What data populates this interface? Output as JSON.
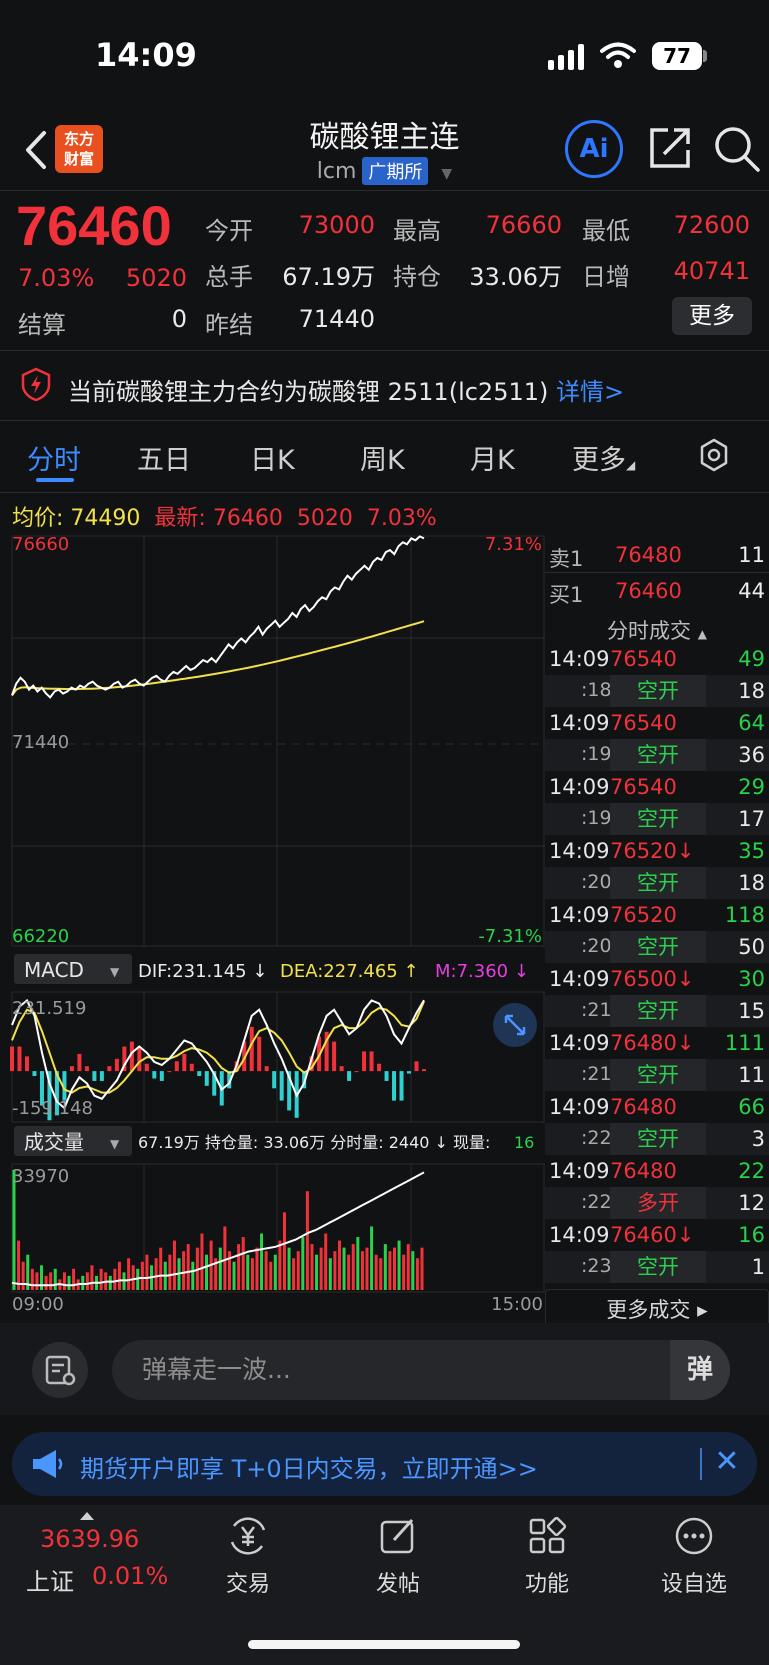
{
  "status": {
    "time": "14:09",
    "battery": "77"
  },
  "header": {
    "logo_line1": "东方",
    "logo_line2": "财富",
    "title": "碳酸锂主连",
    "code": "lcm",
    "exchange": "广期所",
    "ai_label": "Ai"
  },
  "quote": {
    "last": "76460",
    "change_pct": "7.03%",
    "change": "5020",
    "open_label": "今开",
    "open": "73000",
    "high_label": "最高",
    "high": "76660",
    "low_label": "最低",
    "low": "72600",
    "volume_label": "总手",
    "volume": "67.19万",
    "oi_label": "持仓",
    "oi": "33.06万",
    "daily_inc_label": "日增",
    "daily_inc": "40741",
    "settle_label": "结算",
    "settle": "0",
    "prev_settle_label": "昨结",
    "prev_settle": "71440",
    "more": "更多"
  },
  "notice": {
    "text": "当前碳酸锂主力合约为碳酸锂 2511(lc2511)",
    "link": "详情>"
  },
  "tabs": [
    "分时",
    "五日",
    "日K",
    "周K",
    "月K",
    "更多"
  ],
  "info_line": {
    "avg_label": "均价:",
    "avg": "74490",
    "latest_label": "最新:",
    "latest": "76460",
    "latest_change": "5020",
    "latest_pct": "7.03%"
  },
  "chart_data": {
    "type": "line",
    "price_axis": {
      "top": "76660",
      "mid": "71440",
      "bottom": "66220",
      "top_pct": "7.31%",
      "bottom_pct": "-7.31%",
      "ylim": [
        66220,
        76660
      ],
      "prev_settle": 71440
    },
    "x_labels": {
      "start": "09:00",
      "end": "15:00"
    },
    "series": [
      {
        "name": "最新",
        "color": "#ffffff",
        "values": [
          72600,
          72900,
          73050,
          72950,
          72750,
          72850,
          72700,
          72800,
          72650,
          72550,
          72700,
          72750,
          72650,
          72700,
          72800,
          72750,
          72850,
          72800,
          72900,
          72950,
          72850,
          72800,
          72750,
          72800,
          72900,
          72950,
          72800,
          72850,
          72950,
          73000,
          72900,
          72850,
          72950,
          73050,
          73100,
          73000,
          72950,
          73100,
          73200,
          73150,
          73250,
          73350,
          73250,
          73300,
          73400,
          73500,
          73450,
          73550,
          73450,
          73600,
          73750,
          73900,
          73800,
          73950,
          74050,
          73950,
          74100,
          74200,
          74350,
          74150,
          74300,
          74400,
          74500,
          74350,
          74450,
          74550,
          74700,
          74600,
          74800,
          74900,
          74750,
          74850,
          75000,
          75100,
          75050,
          75250,
          75350,
          75300,
          75500,
          75650,
          75550,
          75700,
          75800,
          75900,
          75800,
          76000,
          76100,
          76050,
          76250,
          76300,
          76200,
          76400,
          76500,
          76450,
          76600,
          76550,
          76650,
          76600
        ]
      },
      {
        "name": "均价",
        "color": "#f2e14a",
        "values": [
          72600,
          72750,
          72800,
          72810,
          72800,
          72790,
          72785,
          72780,
          72775,
          72770,
          72768,
          72766,
          72764,
          72762,
          72762,
          72764,
          72766,
          72768,
          72772,
          72778,
          72784,
          72790,
          72798,
          72806,
          72815,
          72825,
          72836,
          72848,
          72860,
          72873,
          72886,
          72900,
          72915,
          72930,
          72946,
          72962,
          72978,
          72994,
          73010,
          73026,
          73043,
          73060,
          73078,
          73096,
          73114,
          73133,
          73152,
          73172,
          73192,
          73213,
          73234,
          73256,
          73278,
          73300,
          73323,
          73347,
          73371,
          73396,
          73421,
          73447,
          73473,
          73500,
          73527,
          73555,
          73583,
          73611,
          73640,
          73669,
          73698,
          73727,
          73756,
          73785,
          73815,
          73845,
          73875,
          73905,
          73936,
          73967,
          73998,
          74030,
          74062,
          74094,
          74126,
          74159,
          74192,
          74225,
          74258,
          74291,
          74324,
          74357,
          74390,
          74423,
          74456,
          74490
        ]
      }
    ],
    "macd": {
      "selector": "MACD",
      "dif_label": "DIF:231.145 ↓",
      "dea_label": "DEA:227.465 ↑",
      "m_label": "M:7.360 ↓",
      "top": "231.519",
      "bottom": "-159.148",
      "dif": [
        150,
        210,
        230,
        180,
        60,
        -40,
        -100,
        -120,
        -60,
        -20,
        -40,
        -80,
        -90,
        -60,
        -30,
        20,
        60,
        80,
        60,
        30,
        20,
        40,
        70,
        100,
        90,
        60,
        30,
        -10,
        -60,
        -40,
        20,
        100,
        180,
        200,
        150,
        90,
        40,
        -20,
        -80,
        -40,
        40,
        120,
        180,
        200,
        160,
        120,
        140,
        200,
        230,
        220,
        180,
        120,
        90,
        140,
        190,
        231
      ],
      "dea": [
        100,
        160,
        200,
        190,
        130,
        60,
        -10,
        -60,
        -70,
        -55,
        -50,
        -60,
        -70,
        -70,
        -55,
        -30,
        0,
        30,
        45,
        45,
        40,
        40,
        50,
        65,
        75,
        70,
        60,
        40,
        10,
        -5,
        0,
        40,
        90,
        130,
        140,
        125,
        100,
        60,
        15,
        -5,
        10,
        50,
        100,
        140,
        150,
        140,
        140,
        160,
        190,
        205,
        200,
        180,
        150,
        145,
        170,
        227
      ]
    },
    "volume": {
      "selector": "成交量",
      "summary_prefix": "67.19万 持仓量: 33.06万 分时量: 2440 ↓ 现量:",
      "current": "16",
      "top": "33970",
      "bars": [
        34,
        14,
        8,
        10,
        6,
        5,
        7,
        4,
        5,
        6,
        3,
        5,
        4,
        6,
        3,
        4,
        5,
        7,
        4,
        6,
        5,
        4,
        6,
        8,
        5,
        9,
        7,
        6,
        8,
        10,
        7,
        9,
        12,
        8,
        10,
        14,
        9,
        11,
        13,
        8,
        12,
        16,
        10,
        14,
        9,
        12,
        18,
        11,
        8,
        13,
        15,
        10,
        9,
        12,
        16,
        11,
        8,
        10,
        14,
        22,
        12,
        9,
        11,
        15,
        28,
        13,
        10,
        12,
        16,
        9,
        11,
        14,
        12,
        10,
        13,
        15,
        11,
        12,
        18,
        10,
        9,
        13,
        11,
        12,
        14,
        10,
        13,
        11,
        9,
        12
      ],
      "oi_line": [
        6,
        5,
        5,
        4,
        4,
        4,
        4,
        5,
        4,
        4,
        5,
        5,
        6,
        6,
        7,
        7,
        8,
        8,
        9,
        10,
        10,
        11,
        12,
        12,
        13,
        14,
        15,
        16,
        18,
        20,
        22,
        24,
        26,
        28,
        30,
        32,
        33,
        34,
        35,
        36,
        38,
        40,
        42,
        45,
        48,
        50,
        53,
        56,
        59,
        62,
        65,
        68,
        71,
        74,
        77,
        80,
        83,
        86,
        89,
        92,
        95,
        98
      ]
    }
  },
  "order_book": [
    {
      "label": "卖1",
      "price": "76480",
      "vol": "11"
    },
    {
      "label": "买1",
      "price": "76460",
      "vol": "44"
    }
  ],
  "ticks_header": "分时成交",
  "ticks": [
    {
      "time": "14:09",
      "price": "76540",
      "vol": "49",
      "sub": ":18",
      "action": "空开",
      "action_color": "green",
      "sub_vol": "18"
    },
    {
      "time": "14:09",
      "price": "76540",
      "vol": "64",
      "sub": ":19",
      "action": "空开",
      "action_color": "green",
      "sub_vol": "36"
    },
    {
      "time": "14:09",
      "price": "76540",
      "vol": "29",
      "sub": ":19",
      "action": "空开",
      "action_color": "green",
      "sub_vol": "17"
    },
    {
      "time": "14:09",
      "price": "76520↓",
      "vol": "35",
      "sub": ":20",
      "action": "空开",
      "action_color": "green",
      "sub_vol": "18"
    },
    {
      "time": "14:09",
      "price": "76520",
      "vol": "118",
      "sub": ":20",
      "action": "空开",
      "action_color": "green",
      "sub_vol": "50"
    },
    {
      "time": "14:09",
      "price": "76500↓",
      "vol": "30",
      "sub": ":21",
      "action": "空开",
      "action_color": "green",
      "sub_vol": "15"
    },
    {
      "time": "14:09",
      "price": "76480↓",
      "vol": "111",
      "sub": ":21",
      "action": "空开",
      "action_color": "green",
      "sub_vol": "11"
    },
    {
      "time": "14:09",
      "price": "76480",
      "vol": "66",
      "sub": ":22",
      "action": "空开",
      "action_color": "green",
      "sub_vol": "3"
    },
    {
      "time": "14:09",
      "price": "76480",
      "vol": "22",
      "sub": ":22",
      "action": "多开",
      "action_color": "red",
      "sub_vol": "12"
    },
    {
      "time": "14:09",
      "price": "76460↓",
      "vol": "16",
      "sub": ":23",
      "action": "空开",
      "action_color": "green",
      "sub_vol": "1"
    }
  ],
  "more_trades": "更多成交 ▸",
  "comment": {
    "placeholder": "弹幕走一波...",
    "danmu": "弹"
  },
  "promo": {
    "text": "期货开户即享 T+0日内交易，立即开通>>",
    "close": "✕"
  },
  "bottom_nav": {
    "index_value": "3639.96",
    "index_name": "上证",
    "index_change": "0.01%",
    "items": [
      "交易",
      "发帖",
      "功能",
      "设自选"
    ]
  }
}
